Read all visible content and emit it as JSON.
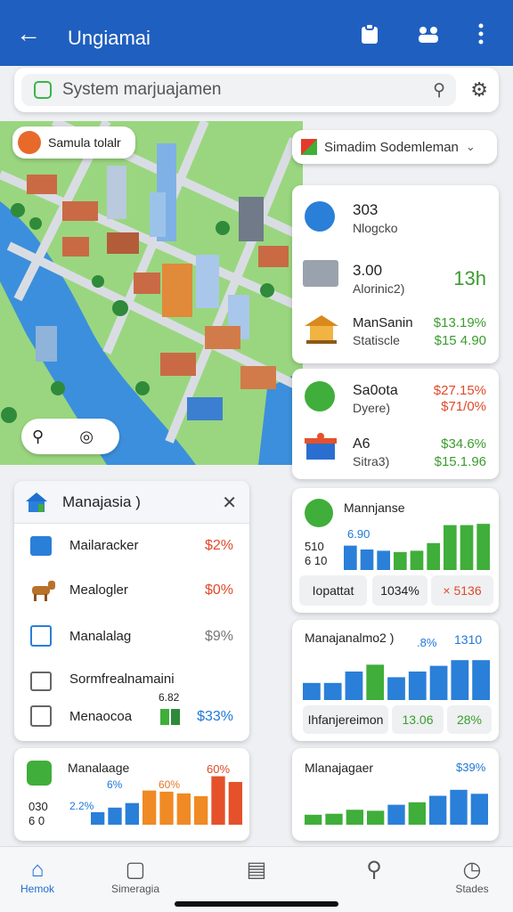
{
  "appbar": {
    "title": "Ungiamai",
    "back_icon": "arrow-left-icon",
    "icons": [
      "clipboard-icon",
      "people-icon",
      "more-vertical-icon"
    ]
  },
  "search": {
    "value": "System marjuajamen"
  },
  "map": {
    "location_chip": "Samula tolalr",
    "dropdown": "Simadim Sodemleman"
  },
  "stats_card": {
    "items": [
      {
        "value": "303",
        "label": "Nlogcko"
      },
      {
        "value": "3.00",
        "label": "Alorinic2)",
        "extra": "13h",
        "extra_color": "#4aa82e"
      },
      {
        "name": "ManSanin",
        "sub": "Statiscle",
        "v1": "$13.19%",
        "v2": "$15 4.90"
      }
    ]
  },
  "stats_card2": {
    "items": [
      {
        "name": "Sa0ota",
        "sub": "Dyere)",
        "v1": "$27.15%",
        "v2": "$71/0%"
      },
      {
        "name": "A6",
        "sub": "Sitra3)",
        "v1": "$34.6%",
        "v2": "$15.1.96"
      }
    ]
  },
  "manage_panel": {
    "title": "Manajasia )",
    "rows": [
      {
        "label": "Mailaracker",
        "value": "$2%",
        "color": "#e04a2a"
      },
      {
        "label": "Mealogler",
        "value": "$0%",
        "color": "#e04a2a"
      },
      {
        "label": "Manalalag",
        "value": "$9%",
        "color": "#555555"
      },
      {
        "label": "Sormfrealnamaini",
        "value": "",
        "color": "#555555"
      },
      {
        "label": "Menaocoa",
        "value": "$33%",
        "color": "#1f77d8"
      }
    ],
    "mini_value": "6.82"
  },
  "chart_panels": {
    "a": {
      "title": "Mannjanse",
      "v1": "6.90",
      "y1": "510",
      "y2": "6 10",
      "btn1": "Iopattat",
      "btn2": "1034%",
      "btn3": "× 5136"
    },
    "b": {
      "title": "Manajanalmo2 )",
      "v1": ".8%",
      "v2": "1310",
      "btn1": "Ihfanjereimon",
      "btn2": "13.06",
      "btn3": "28%"
    },
    "c": {
      "title": "Manalaage",
      "v1": "60%",
      "v2": "6%",
      "v3": "60%",
      "v4": "2.2%",
      "y1": "030",
      "y2": "6 0"
    },
    "d": {
      "title": "Mlanajagaer",
      "v1": "$39%"
    }
  },
  "chart_data": [
    {
      "type": "bar",
      "values": [
        38,
        32,
        30,
        28,
        30,
        42,
        70,
        70,
        72
      ],
      "colors": [
        "#2a7fd8",
        "#2a7fd8",
        "#2a7fd8",
        "#3fae3a",
        "#3fae3a",
        "#3fae3a",
        "#3fae3a",
        "#3fae3a",
        "#3fae3a"
      ]
    },
    {
      "type": "bar",
      "values": [
        30,
        30,
        50,
        62,
        40,
        50,
        60,
        70,
        70
      ],
      "colors": [
        "#2a7fd8",
        "#2a7fd8",
        "#2a7fd8",
        "#3fae3a",
        "#2a7fd8",
        "#2a7fd8",
        "#2a7fd8",
        "#2a7fd8",
        "#2a7fd8"
      ]
    },
    {
      "type": "bar",
      "values": [
        22,
        30,
        38,
        60,
        58,
        55,
        50,
        85,
        75
      ],
      "colors": [
        "#2a7fd8",
        "#2a7fd8",
        "#2a7fd8",
        "#f08a24",
        "#f08a24",
        "#f08a24",
        "#f08a24",
        "#e5512a",
        "#e5512a"
      ]
    },
    {
      "type": "bar",
      "values": [
        20,
        22,
        30,
        28,
        40,
        45,
        58,
        70,
        62
      ],
      "colors": [
        "#3fae3a",
        "#3fae3a",
        "#3fae3a",
        "#3fae3a",
        "#2a7fd8",
        "#3fae3a",
        "#2a7fd8",
        "#2a7fd8",
        "#2a7fd8"
      ]
    }
  ],
  "bottomnav": [
    {
      "label": "Hemok",
      "icon": "home-icon",
      "active": true
    },
    {
      "label": "Simeragia",
      "icon": "package-icon",
      "active": false
    },
    {
      "label": "",
      "icon": "clipboard-badge-icon",
      "active": false
    },
    {
      "label": "",
      "icon": "search-map-icon",
      "active": false
    },
    {
      "label": "Stades",
      "icon": "compass-icon",
      "active": false
    }
  ]
}
